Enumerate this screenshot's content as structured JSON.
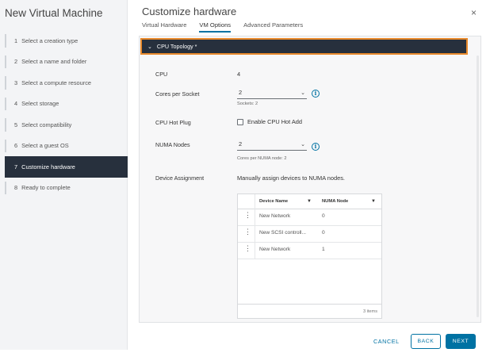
{
  "wizard": {
    "title": "New Virtual Machine",
    "steps": [
      {
        "num": "1",
        "label": "Select a creation type"
      },
      {
        "num": "2",
        "label": "Select a name and folder"
      },
      {
        "num": "3",
        "label": "Select a compute resource"
      },
      {
        "num": "4",
        "label": "Select storage"
      },
      {
        "num": "5",
        "label": "Select compatibility"
      },
      {
        "num": "6",
        "label": "Select a guest OS"
      },
      {
        "num": "7",
        "label": "Customize hardware"
      },
      {
        "num": "8",
        "label": "Ready to complete"
      }
    ],
    "active_step": 7
  },
  "header": {
    "title": "Customize hardware",
    "close_glyph": "×",
    "tabs": [
      "Virtual Hardware",
      "VM Options",
      "Advanced Parameters"
    ],
    "active_tab": "VM Options"
  },
  "section": {
    "chevron": "⌄",
    "title": "CPU Topology *"
  },
  "fields": {
    "cpu": {
      "label": "CPU",
      "value": "4"
    },
    "cores_per_socket": {
      "label": "Cores per Socket",
      "value": "2",
      "hint": "Sockets: 2"
    },
    "cpu_hot_plug": {
      "label": "CPU Hot Plug",
      "checkbox_label": "Enable CPU Hot Add",
      "checked": false
    },
    "numa_nodes": {
      "label": "NUMA Nodes",
      "value": "2",
      "hint": "Cores per NUMA node: 2"
    },
    "device_assignment": {
      "label": "Device Assignment",
      "value": "Manually assign devices to NUMA nodes."
    }
  },
  "device_grid": {
    "columns": [
      "Device Name",
      "NUMA Node"
    ],
    "rows": [
      {
        "device": "New Network",
        "numa": "0"
      },
      {
        "device": "New SCSI controll...",
        "numa": "0"
      },
      {
        "device": "New Network",
        "numa": "1"
      }
    ],
    "footer": "3 items"
  },
  "icons": {
    "caret": "⌄",
    "info": "i",
    "filter": "▼",
    "row_menu": "⋮"
  },
  "footer": {
    "cancel": "CANCEL",
    "back": "BACK",
    "next": "NEXT"
  },
  "colors": {
    "accent": "#0072a3",
    "active_step_bg": "#27303d",
    "focus_outline": "#e98a2c"
  }
}
